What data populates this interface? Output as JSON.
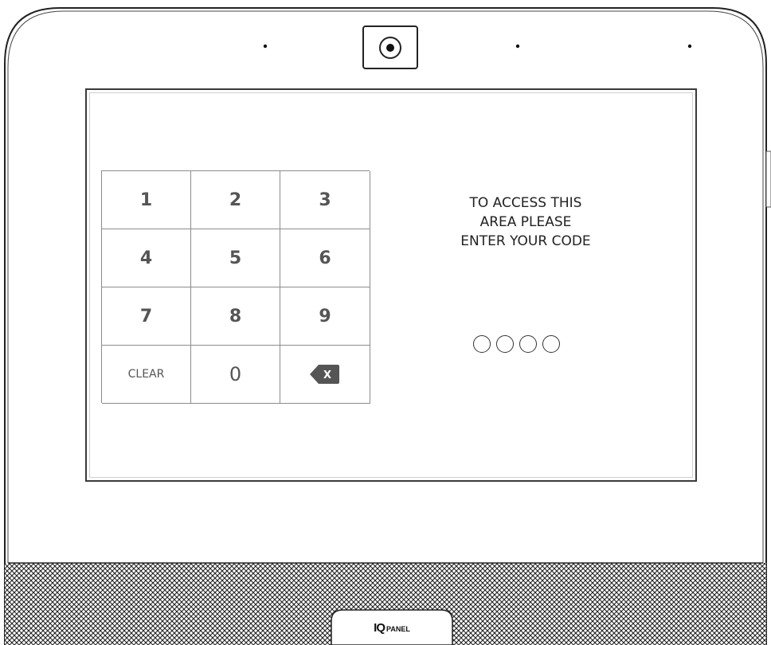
{
  "keypad": {
    "keys": [
      "1",
      "2",
      "3",
      "4",
      "5",
      "6",
      "7",
      "8",
      "9",
      "CLEAR",
      "0"
    ],
    "backspace_glyph": "X"
  },
  "prompt": {
    "lines": [
      "TO ACCESS THIS",
      "AREA PLEASE",
      "ENTER YOUR CODE"
    ]
  },
  "code_entry": {
    "digits_total": 4,
    "digits_entered": 0
  },
  "branding": {
    "logo_iq": "IQ",
    "logo_panel": "PANEL"
  },
  "colors": {
    "frame": "#222222",
    "key_text": "#555555",
    "grille": "#222222"
  }
}
